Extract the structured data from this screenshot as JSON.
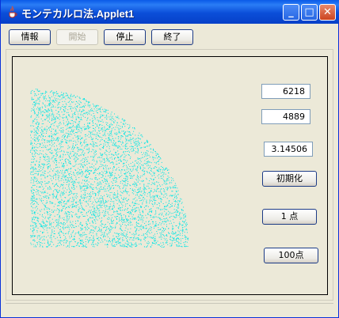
{
  "window": {
    "title": "モンテカルロ法.Applet1"
  },
  "title_icon": "java-cup-icon",
  "title_controls": {
    "minimize": "_",
    "maximize": "□",
    "close": "✕"
  },
  "toolbar": {
    "info": "情報",
    "start": "開始",
    "stop": "停止",
    "exit": "終了"
  },
  "counters": {
    "total": "6218",
    "inside": "4889",
    "pi_estimate": "3.14506"
  },
  "buttons": {
    "reset": "初期化",
    "one_point": "1 点",
    "hundred_points": "100点"
  },
  "colors": {
    "dot": "#00e5e5",
    "background": "#ece9d8",
    "titlebar": "#0a5ae8"
  }
}
